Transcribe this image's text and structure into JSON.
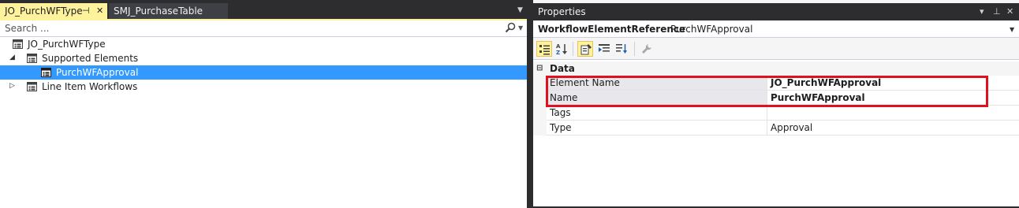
{
  "tabs": {
    "active": {
      "label": "JO_PurchWFType",
      "pin_glyph": "⊣",
      "close_glyph": "✕"
    },
    "inactive": {
      "label": "SMJ_PurchaseTable"
    },
    "overflow_glyph": "▼"
  },
  "search": {
    "placeholder": "Search ..."
  },
  "tree": {
    "root": {
      "label": "JO_PurchWFType"
    },
    "supported_elements": {
      "label": "Supported Elements",
      "expanded": true
    },
    "purch_wf_approval": {
      "label": "PurchWFApproval",
      "selected": true
    },
    "line_item_workflows": {
      "label": "Line Item Workflows",
      "expanded": false
    }
  },
  "properties": {
    "title": "Properties",
    "title_controls": {
      "dropdown": "▾",
      "pin": "⊥",
      "close": "✕"
    },
    "object_type": "WorkflowElementReference",
    "object_name": "PurchWFApproval",
    "category": "Data",
    "rows": [
      {
        "name": "Element Name",
        "value": "JO_PurchWFApproval",
        "bold_value": true
      },
      {
        "name": "Name",
        "value": "PurchWFApproval",
        "bold_value": true
      },
      {
        "name": "Tags",
        "value": "",
        "bold_value": false
      },
      {
        "name": "Type",
        "value": "Approval",
        "bold_value": false
      }
    ]
  },
  "colors": {
    "active_tab": "#fff29d",
    "selection": "#3399ff",
    "highlight_box": "#e0101e",
    "chrome": "#2d2d30"
  },
  "icons": [
    "search-icon",
    "class-node-icon",
    "categorized-icon",
    "alphabetical-icon",
    "property-pages-icon",
    "events-icon",
    "sort-icon",
    "wrench-icon"
  ]
}
